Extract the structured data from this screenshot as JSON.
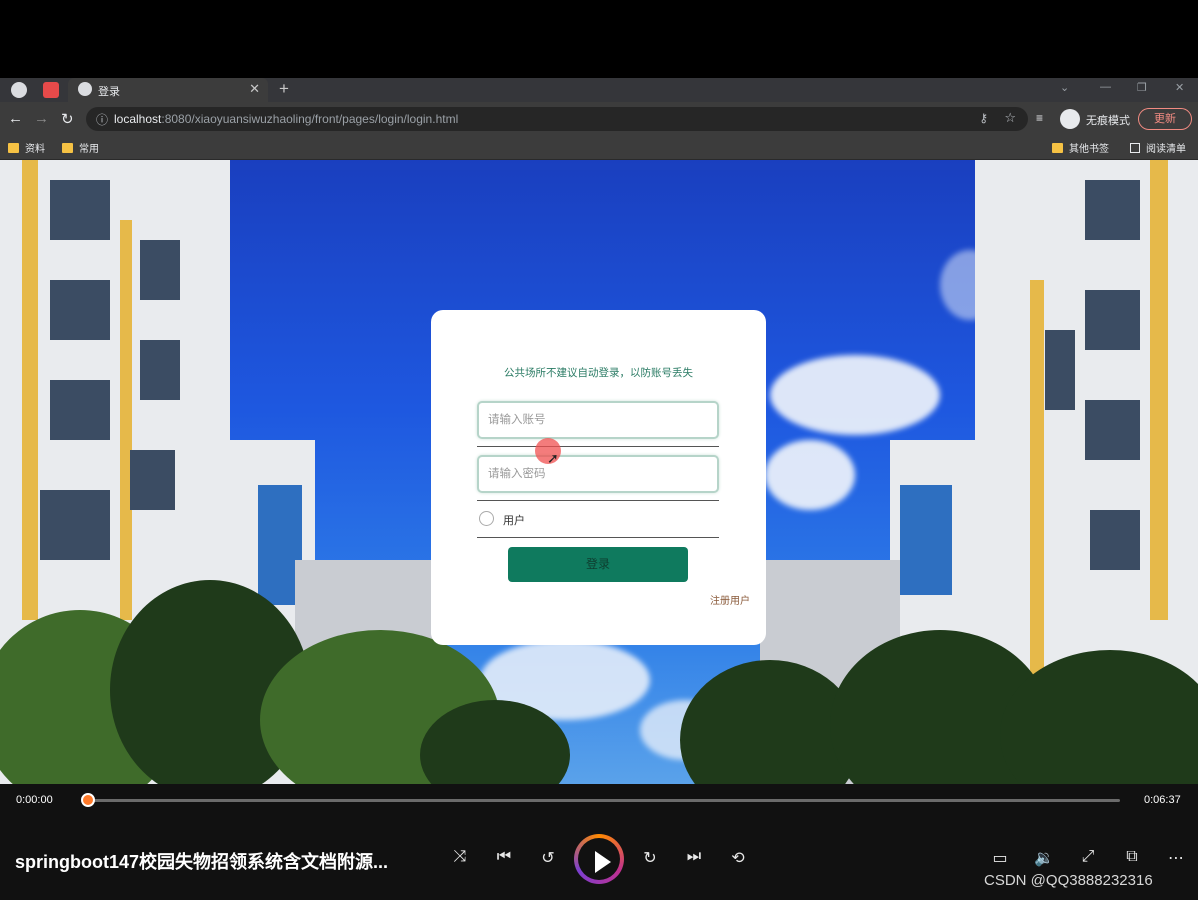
{
  "browser": {
    "tab_title": "登录",
    "url_host": "localhost",
    "url_rest": ":8080/xiaoyuansiwuzhaoling/front/pages/login/login.html",
    "incognito_label": "无痕模式",
    "update_label": "更新",
    "bookmarks": [
      "资料",
      "常用"
    ],
    "other_bookmarks": "其他书签",
    "reading_list": "阅读清单"
  },
  "login": {
    "notice": "公共场所不建议自动登录，以防账号丢失",
    "account_placeholder": "请输入账号",
    "password_placeholder": "请输入密码",
    "role_label": "用户",
    "login_button": "登录",
    "register_link": "注册用户"
  },
  "player": {
    "current_time": "0:00:00",
    "total_time": "0:06:37",
    "progress": 0.0,
    "title": "springboot147校园失物招领系统含文档附源...",
    "watermark": "CSDN @QQ3888232316"
  },
  "colors": {
    "primary_green": "#0f7a5e",
    "progress_orange": "#ff7a2a"
  }
}
